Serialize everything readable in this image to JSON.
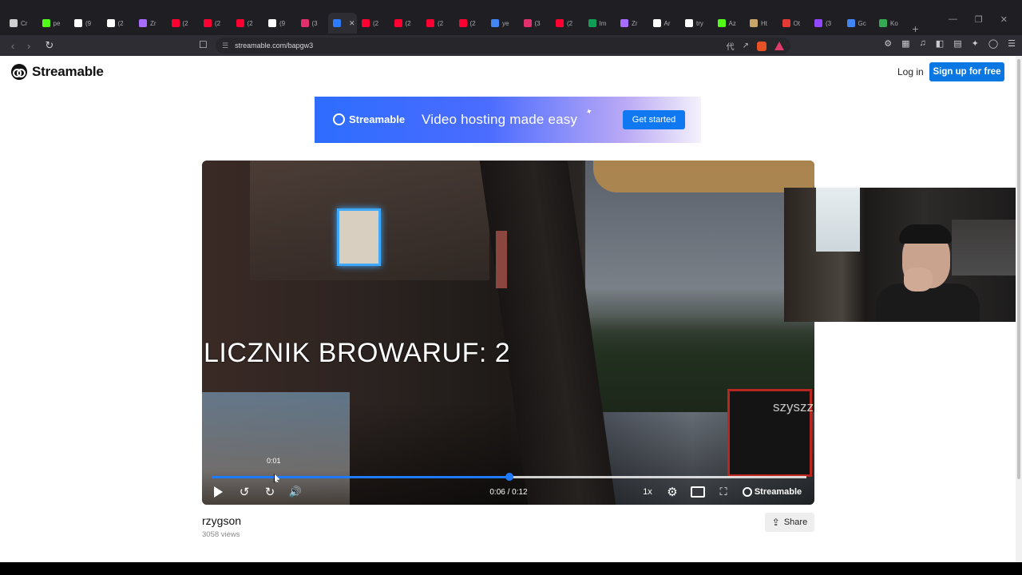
{
  "browser": {
    "tabs": [
      {
        "label": "Cr",
        "icon": "stack-icon",
        "color": "#cfcfcf"
      },
      {
        "label": "pe",
        "icon": "kick-icon",
        "color": "#53fc18"
      },
      {
        "label": "(9",
        "icon": "tiktok-icon",
        "color": "#ffffff"
      },
      {
        "label": "(2",
        "icon": "x-icon",
        "color": "#ffffff"
      },
      {
        "label": "Zr",
        "icon": "feather-icon",
        "color": "#a86bff"
      },
      {
        "label": "(2",
        "icon": "youtube-icon",
        "color": "#ff0033"
      },
      {
        "label": "(2",
        "icon": "youtube-icon",
        "color": "#ff0033"
      },
      {
        "label": "(2",
        "icon": "youtube-icon",
        "color": "#ff0033"
      },
      {
        "label": "(9",
        "icon": "tiktok-icon",
        "color": "#ffffff"
      },
      {
        "label": "(3",
        "icon": "instagram-icon",
        "color": "#e1306c"
      },
      {
        "label": "",
        "icon": "streamable-icon",
        "color": "#2d7bff",
        "active": true
      },
      {
        "label": "(2",
        "icon": "youtube-icon",
        "color": "#ff0033"
      },
      {
        "label": "(2",
        "icon": "youtube-icon",
        "color": "#ff0033"
      },
      {
        "label": "(2",
        "icon": "youtube-icon",
        "color": "#ff0033"
      },
      {
        "label": "(2",
        "icon": "youtube-icon",
        "color": "#ff0033"
      },
      {
        "label": "ye",
        "icon": "calendar-icon",
        "color": "#4285f4"
      },
      {
        "label": "(3",
        "icon": "instagram-icon",
        "color": "#e1306c"
      },
      {
        "label": "(2",
        "icon": "youtube-icon",
        "color": "#ff0033"
      },
      {
        "label": "Im",
        "icon": "sheet-icon",
        "color": "#0f9d58"
      },
      {
        "label": "Zr",
        "icon": "feather-icon",
        "color": "#a86bff"
      },
      {
        "label": "Ar",
        "icon": "tiktok-icon",
        "color": "#ffffff"
      },
      {
        "label": "try",
        "icon": "google-icon",
        "color": "#ffffff"
      },
      {
        "label": "Az",
        "icon": "kick-icon",
        "color": "#53fc18"
      },
      {
        "label": "Ht",
        "icon": "oval-icon",
        "color": "#caa56a"
      },
      {
        "label": "Ot",
        "icon": "flag-icon",
        "color": "#e53935"
      },
      {
        "label": "(3",
        "icon": "twitch-icon",
        "color": "#9146ff"
      },
      {
        "label": "Gc",
        "icon": "bulb-icon",
        "color": "#4285f4"
      },
      {
        "label": "Ko",
        "icon": "maps-icon",
        "color": "#34a853"
      }
    ],
    "new_tab": "+",
    "url": "streamable.com/bapgw3"
  },
  "site": {
    "logo": "Streamable",
    "login": "Log in",
    "signup": "Sign up for free"
  },
  "banner": {
    "brand": "Streamable",
    "headline": "Video hosting made easy",
    "cta": "Get started"
  },
  "video": {
    "overlay_text": "LICZNIK BROWARUF: 2",
    "watermark_text": "szyszz",
    "hover_time": "0:01",
    "current_time": "0:06",
    "duration": "0:12",
    "time_readout": "0:06 / 0:12",
    "speed": "1x",
    "brand": "Streamable",
    "progress_fraction": 0.5,
    "hover_fraction": 0.11
  },
  "meta": {
    "uploader": "rzygson",
    "views": "3058 views",
    "share": "Share"
  },
  "colors": {
    "accent": "#0b77e3",
    "progress": "#1e7bff"
  }
}
